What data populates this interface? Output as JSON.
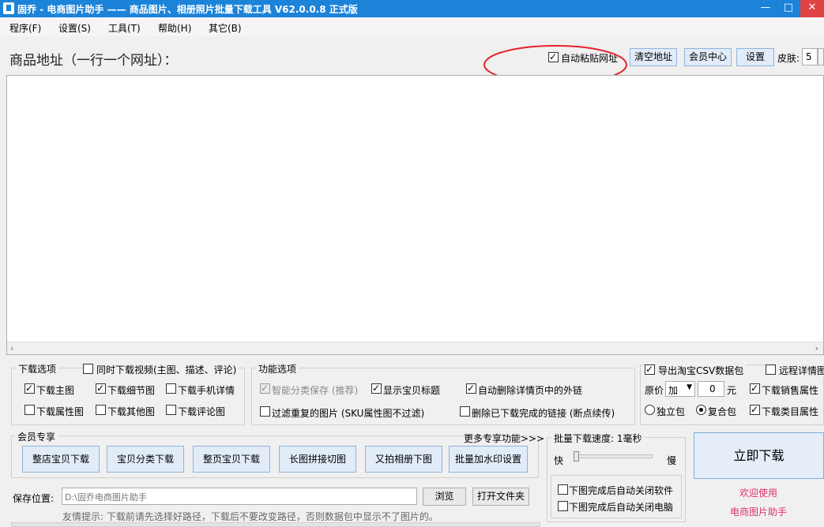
{
  "window": {
    "title": "固乔 - 电商图片助手 —— 商品图片、相册照片批量下载工具 V62.0.0.8 正式版",
    "minimize_glyph": "—",
    "maximize_glyph": "□",
    "close_glyph": "✕"
  },
  "menu": [
    "程序(F)",
    "设置(S)",
    "工具(T)",
    "帮助(H)",
    "其它(B)"
  ],
  "header": {
    "url_label": "商品地址（一行一个网址）：",
    "auto_paste_label": "自动粘贴网址",
    "auto_paste_checked": true,
    "clear_button": "清空地址",
    "member_button": "会员中心",
    "settings_button": "设置",
    "skin_label": "皮肤:",
    "skin_value": "5"
  },
  "url_input": {
    "value": ""
  },
  "download_options": {
    "title": "下载选项",
    "simul_video": {
      "label": "同时下载视频(主图、描述、评论)",
      "checked": false
    },
    "items": [
      {
        "label": "下载主图",
        "checked": true
      },
      {
        "label": "下载细节图",
        "checked": true
      },
      {
        "label": "下载手机详情",
        "checked": false
      },
      {
        "label": "下载属性图",
        "checked": false
      },
      {
        "label": "下载其他图",
        "checked": false
      },
      {
        "label": "下载评论图",
        "checked": false
      }
    ]
  },
  "function_options": {
    "title": "功能选项",
    "smart_save": {
      "label": "智能分类保存 (推荐)",
      "checked": true,
      "disabled": true
    },
    "show_title": {
      "label": "显示宝贝标题",
      "checked": true
    },
    "auto_remove_links": {
      "label": "自动删除详情页中的外链",
      "checked": true
    },
    "filter_dup": {
      "label": "过滤重复的图片 (SKU属性图不过滤)",
      "checked": false
    },
    "delete_done": {
      "label": "删除已下载完成的链接 (断点续传)",
      "checked": false
    }
  },
  "csv_options": {
    "export_csv": {
      "label": "导出淘宝CSV数据包",
      "checked": true
    },
    "remote_detail": {
      "label": "远程详情图",
      "checked": false
    },
    "price_label": "原价",
    "price_op": "加",
    "price_value": "0",
    "price_unit": "元",
    "sales_attr": {
      "label": "下载销售属性",
      "checked": true
    },
    "single_pack": {
      "label": "独立包",
      "checked": false
    },
    "combined_pack": {
      "label": "复合包",
      "checked": true
    },
    "category_attr": {
      "label": "下载类目属性",
      "checked": true
    }
  },
  "member": {
    "title": "会员专享",
    "more": "更多专享功能>>>",
    "buttons": [
      "整店宝贝下载",
      "宝贝分类下载",
      "整页宝贝下载",
      "长图拼接切图",
      "又拍相册下图",
      "批量加水印设置"
    ]
  },
  "speed": {
    "title": "批量下载速度: 1毫秒",
    "fast": "快",
    "slow": "慢",
    "level": 0
  },
  "after": {
    "close_app": {
      "label": "下图完成后自动关闭软件",
      "checked": false
    },
    "shutdown": {
      "label": "下图完成后自动关闭电脑",
      "checked": false
    }
  },
  "download_button": "立即下载",
  "welcome": [
    "欢迎使用",
    "电商图片助手"
  ],
  "save": {
    "label": "保存位置:",
    "path": "D:\\固乔电商图片助手",
    "browse": "浏览",
    "open_folder": "打开文件夹",
    "tip": "友情提示: 下载前请先选择好路径，下载后不要改变路径，否则数据包中显示不了图片的。"
  },
  "colors": {
    "titlebar": "#1b83d8",
    "annotation": "#e8202a",
    "welcome": "#e0306a"
  }
}
